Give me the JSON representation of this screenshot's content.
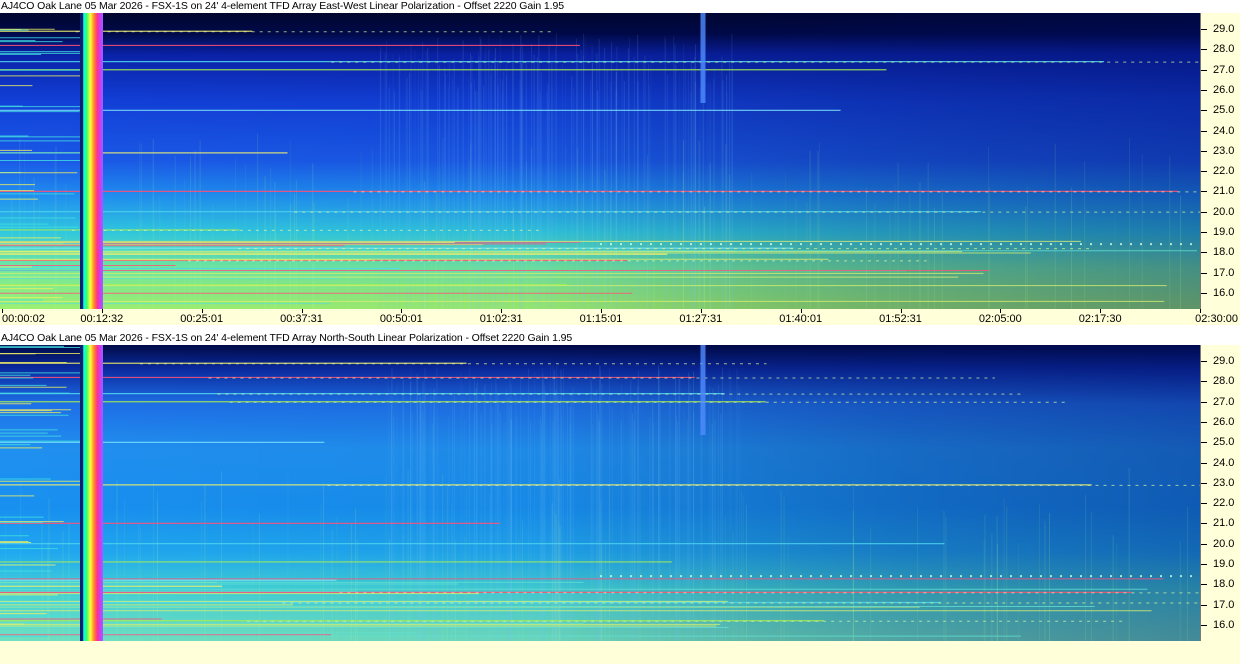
{
  "colors": {
    "axis_background": "#ffffd9",
    "spectrogram_low": "#00003c",
    "spectrogram_mid": "#1450e6",
    "spectrogram_high": "#a0f03c",
    "interference_line": "#ff5078"
  },
  "chart_data": [
    {
      "type": "heatmap",
      "title": "AJ4CO Oak Lane 05 Mar 2026 - FSX-1S on 24' 4-element TFD Array East-West Linear Polarization  -  Offset 2220  Gain 1.95",
      "xlabel": "",
      "ylabel": "",
      "x_tick_labels": [
        "00:00:02",
        "00:12:32",
        "00:25:01",
        "00:37:31",
        "00:50:01",
        "01:02:31",
        "01:15:01",
        "01:27:31",
        "01:40:01",
        "01:52:31",
        "02:05:00",
        "02:17:30",
        "02:30:00"
      ],
      "x_range": [
        "00:00:02",
        "02:30:00"
      ],
      "y_ticks": [
        16.0,
        17.0,
        18.0,
        19.0,
        20.0,
        21.0,
        22.0,
        23.0,
        24.0,
        25.0,
        26.0,
        27.0,
        28.0,
        29.0
      ],
      "y_tick_labels": [
        "16.0",
        "17.0",
        "18.0",
        "19.0",
        "20.0",
        "21.0",
        "22.0",
        "23.0",
        "24.0",
        "25.0",
        "26.0",
        "27.0",
        "28.0",
        "29.0"
      ],
      "ylim": [
        15.2,
        29.8
      ],
      "y_axis_position": "right",
      "interference_lines_mhz": [
        16.4,
        17.2,
        17.6,
        17.9,
        18.2,
        19.1,
        20.0,
        21.0,
        22.9,
        25.0,
        27.0,
        27.4,
        28.2,
        28.9
      ],
      "broadband_marker_time": "00:12:32"
    },
    {
      "type": "heatmap",
      "title": "AJ4CO Oak Lane 05 Mar 2026 - FSX-1S on 24' 4-element TFD Array North-South Linear Polarization  -  Offset 2220  Gain 1.95",
      "xlabel": "",
      "ylabel": "",
      "x_tick_labels": [],
      "y_ticks": [
        16.0,
        17.0,
        18.0,
        19.0,
        20.0,
        21.0,
        22.0,
        23.0,
        24.0,
        25.0,
        26.0,
        27.0,
        28.0,
        29.0
      ],
      "y_tick_labels": [
        "16.0",
        "17.0",
        "18.0",
        "19.0",
        "20.0",
        "21.0",
        "22.0",
        "23.0",
        "24.0",
        "25.0",
        "26.0",
        "27.0",
        "28.0",
        "29.0"
      ],
      "ylim": [
        15.2,
        29.8
      ],
      "y_axis_position": "right",
      "interference_lines_mhz": [
        16.2,
        17.1,
        17.6,
        17.9,
        18.2,
        19.1,
        20.0,
        21.0,
        22.9,
        25.0,
        27.0,
        27.4,
        28.2,
        28.9
      ],
      "broadband_marker_time": "00:12:32"
    }
  ]
}
